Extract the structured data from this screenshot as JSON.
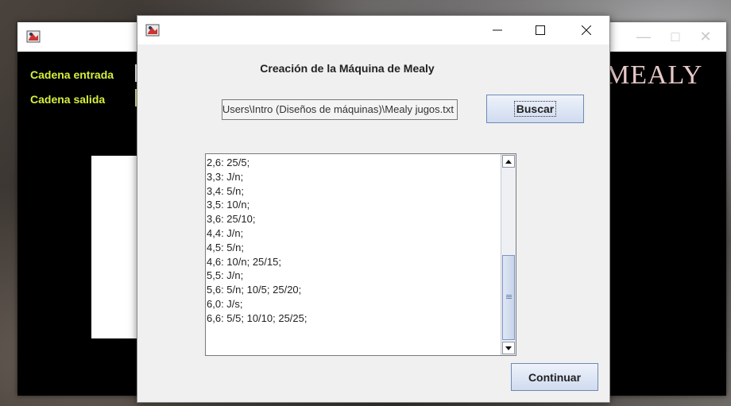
{
  "background_window": {
    "labels": {
      "input": "Cadena entrada",
      "output": "Cadena salida"
    },
    "title_fragment": "MEALY",
    "controls": {
      "minimize": "—",
      "maximize": "□",
      "close": "✕"
    }
  },
  "dialog": {
    "heading": "Creación de la Máquina de Mealy",
    "file_path": "C:\\Users\\Intro (Diseños de máquinas)\\Mealy jugos.txt",
    "browse_label": "Buscar",
    "continue_label": "Continuar",
    "lines": [
      "2,6: 25/5;",
      "3,3: J/n;",
      "3,4: 5/n;",
      "3,5: 10/n;",
      "3,6: 25/10;",
      "4,4: J/n;",
      "4,5: 5/n;",
      "4,6: 10/n; 25/15;",
      "5,5: J/n;",
      "5,6: 5/n; 10/5; 25/20;",
      "6,0: J/s;",
      "6,6: 5/5; 10/10; 25/25;"
    ],
    "scroll_position": 0.62
  },
  "colors": {
    "accent_label": "#d8ef3c",
    "button_border": "#6f88b6"
  },
  "icons": [
    "java-app-icon",
    "minimize-icon",
    "maximize-icon",
    "close-icon",
    "scroll-up-icon",
    "scroll-down-icon"
  ]
}
